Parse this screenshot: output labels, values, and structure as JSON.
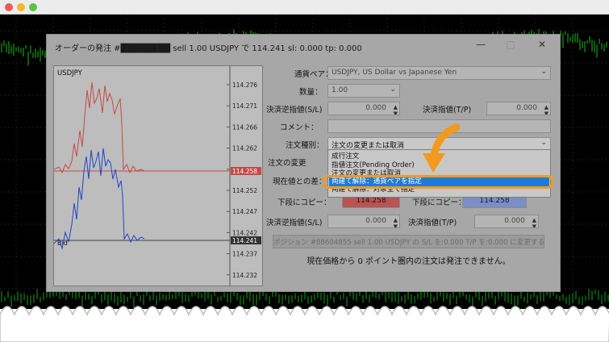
{
  "window": {
    "title": "オーダーの発注 #████████ sell 1.00 USDJPY で 114.241 sl: 0.000 tp: 0.000",
    "minimize": "—",
    "maximize": "□",
    "close": "✕"
  },
  "chart": {
    "symbol": "USDJPY",
    "price_labels": [
      "114.276",
      "114.271",
      "114.266",
      "114.262",
      "114.257",
      "114.252",
      "114.247",
      "114.242",
      "114.237",
      "114.232"
    ],
    "bid_tag": "114.258",
    "ask_tag": "114.241",
    "line_label": "Bid"
  },
  "form": {
    "symbol_label": "通貨ペア：",
    "symbol_value": "USDJPY, US Dollar vs Japanese Yen",
    "volume_label": "数量：",
    "volume_value": "1.00",
    "sl_label": "決済逆指値(S/L)",
    "sl_value": "0.000",
    "tp_label": "決済指値(T/P)",
    "tp_value": "0.000",
    "comment_label": "コメント：",
    "comment_value": "",
    "order_type_label": "注文種別：",
    "order_type_value": "注文の変更または取消",
    "modify_label": "注文の変更",
    "diff_label": "現在値との差：",
    "lower_copy_label": "下段にコピー：",
    "lower_copy_value": "114.258",
    "lower_copy_label2": "下段にコピー：",
    "lower_copy_value2": "114.258",
    "sl2_label": "決済逆指値(S/L)",
    "sl2_value": "0.000",
    "tp2_label": "決済指値(T/P)",
    "tp2_value": "0.000",
    "modify_button": "ポジション #88604855 sell 1.00 USDJPY の S/L を:0.000 T/P を:0.000 に変更する",
    "info_text": "現在価格から 0 ポイント圏内の注文は発注できません。"
  },
  "dropdown": {
    "options": [
      "成行注文",
      "指値注文(Pending Order)",
      "注文の変更または取消",
      "両建て解除：通貨ペアを指定",
      "両建て解除：対象全て指定"
    ],
    "selected_index": 3
  },
  "colors": {
    "highlight": "#f29a1d",
    "selected": "#1e7bd8",
    "bid_line": "#c44a4a",
    "ask_line": "#2244c8"
  }
}
